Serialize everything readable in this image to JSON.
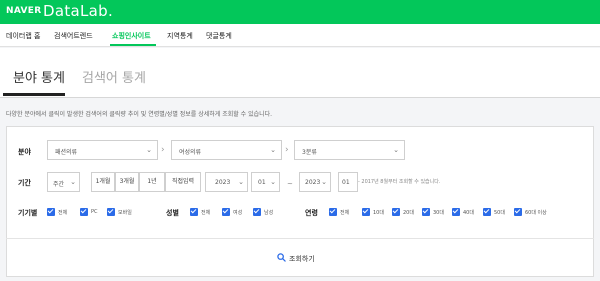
{
  "brand": {
    "naver": "NAVER",
    "datalab": "DataLab."
  },
  "nav": {
    "items": [
      {
        "label": "데이터랩 홈",
        "active": false
      },
      {
        "label": "검색어트렌드",
        "active": false
      },
      {
        "label": "쇼핑인사이트",
        "active": true
      },
      {
        "label": "지역통계",
        "active": false
      },
      {
        "label": "댓글통계",
        "active": false
      }
    ]
  },
  "tabs": [
    {
      "label": "분야 통계",
      "active": true
    },
    {
      "label": "검색어 통계",
      "active": false
    }
  ],
  "description": "다양한 분야에서 클릭이 발생한 검색어의 클릭량 추이 및 연령별/성별 정보를 상세하게 조회할 수 있습니다.",
  "category": {
    "label": "분야",
    "level1": "패션의류",
    "level2": "여성의류",
    "level3": "3분류"
  },
  "period": {
    "label": "기간",
    "unit": "주간",
    "quick": [
      "1개월",
      "3개월",
      "1년",
      "직접입력"
    ],
    "start_year": "2023",
    "start_month": "01",
    "separator": "~",
    "end_year": "2023",
    "end_month": "01",
    "note": "- 2017년 8월부터 조회할 수 있습니다."
  },
  "device": {
    "label": "기기별",
    "options": [
      "전체",
      "PC",
      "모바일"
    ]
  },
  "gender": {
    "label": "성별",
    "options": [
      "전체",
      "여성",
      "남성"
    ]
  },
  "age": {
    "label": "연령",
    "options": [
      "전체",
      "10대",
      "20대",
      "30대",
      "40대",
      "50대",
      "60대 이상"
    ]
  },
  "search_button": "조회하기",
  "colors": {
    "brand_green": "#03c75a",
    "checkbox_blue": "#2b6be8"
  }
}
